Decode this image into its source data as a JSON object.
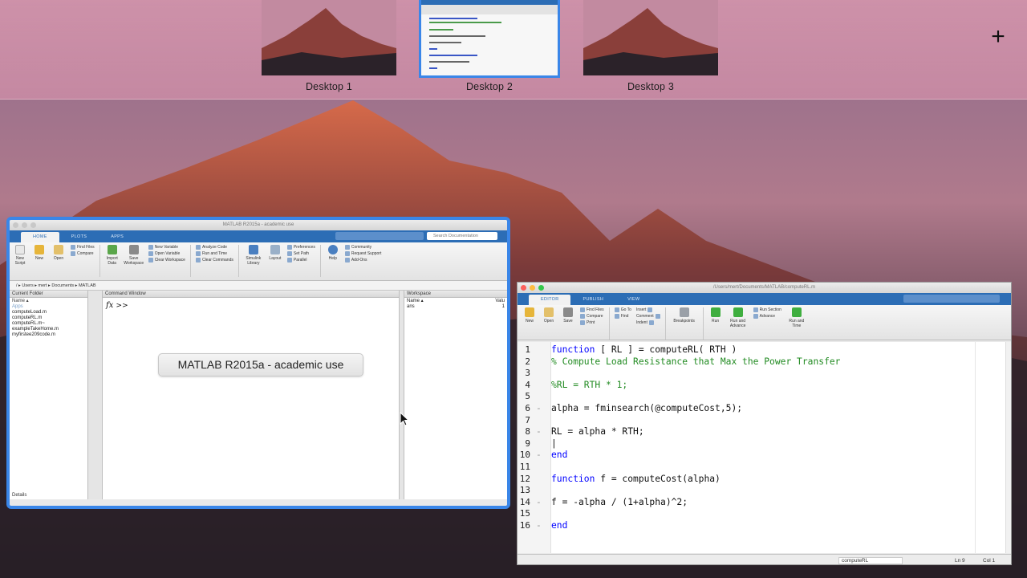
{
  "spaces": [
    {
      "label": "Desktop 1",
      "active": false
    },
    {
      "label": "Desktop 2",
      "active": true
    },
    {
      "label": "Desktop 3",
      "active": false
    }
  ],
  "add_space_symbol": "+",
  "main_window": {
    "title": "MATLAB R2015a - academic use",
    "tabs": [
      "HOME",
      "PLOTS",
      "APPS"
    ],
    "search_placeholder": "Search Documentation",
    "ribbon": {
      "new_script": "New Script",
      "new": "New",
      "open": "Open",
      "find_files": "Find Files",
      "compare": "Compare",
      "import_data": "Import Data",
      "save_workspace": "Save Workspace",
      "new_variable": "New Variable",
      "open_variable": "Open Variable",
      "clear_workspace": "Clear Workspace",
      "analyze_code": "Analyze Code",
      "run_and_time": "Run and Time",
      "clear_commands": "Clear Commands",
      "simulink_library": "Simulink Library",
      "layout": "Layout",
      "preferences": "Preferences",
      "set_path": "Set Path",
      "parallel": "Parallel",
      "help": "Help",
      "community": "Community",
      "request_support": "Request Support",
      "add_ons": "Add-Ons"
    },
    "path": "/ ▸ Users ▸ mert ▸ Documents ▸ MATLAB",
    "current_folder": {
      "title": "Current Folder",
      "column": "Name ▴",
      "items": [
        "Apps",
        "computeLoad.m",
        "computeRL.m",
        "computeRL.m~",
        "exampleTakeHome.m",
        "myfirstee209code.m"
      ],
      "details": "Details"
    },
    "command_window": {
      "title": "Command Window",
      "fx": "fx",
      "prompt": ">>"
    },
    "workspace": {
      "title": "Workspace",
      "col_name": "Name ▴",
      "col_value": "Valu",
      "rows": [
        {
          "name": "ans",
          "value": "1"
        }
      ]
    },
    "tooltip": "MATLAB R2015a - academic use"
  },
  "editor_window": {
    "title": "/Users/mert/Documents/MATLAB/computeRL.m",
    "tabs": [
      "EDITOR",
      "PUBLISH",
      "VIEW"
    ],
    "ribbon": {
      "new": "New",
      "open": "Open",
      "save": "Save",
      "find_files": "Find Files",
      "compare": "Compare",
      "print": "Print",
      "go_to": "Go To",
      "find": "Find",
      "insert": "Insert",
      "comment": "Comment",
      "indent": "Indent",
      "breakpoints": "Breakpoints",
      "run": "Run",
      "run_and_advance": "Run and Advance",
      "run_section": "Run Section",
      "advance": "Advance",
      "run_and_time": "Run and Time"
    },
    "code_lines": [
      {
        "n": "1",
        "dash": "",
        "html": "<span class='kw'>function</span> [ RL ] = computeRL( RTH )"
      },
      {
        "n": "2",
        "dash": "",
        "html": "<span class='cm'>% Compute Load Resistance that Max the Power Transfer</span>"
      },
      {
        "n": "3",
        "dash": "",
        "html": ""
      },
      {
        "n": "4",
        "dash": "",
        "html": "<span class='cm'>%RL = RTH * 1;</span>"
      },
      {
        "n": "5",
        "dash": "",
        "html": ""
      },
      {
        "n": "6",
        "dash": "-",
        "html": "alpha = fminsearch(@computeCost,5);"
      },
      {
        "n": "7",
        "dash": "",
        "html": ""
      },
      {
        "n": "8",
        "dash": "-",
        "html": "RL = alpha * RTH;"
      },
      {
        "n": "9",
        "dash": "",
        "html": "|"
      },
      {
        "n": "10",
        "dash": "-",
        "html": "<span class='kw'>end</span>"
      },
      {
        "n": "11",
        "dash": "",
        "html": ""
      },
      {
        "n": "12",
        "dash": "",
        "html": "<span class='kw'>function</span> f = computeCost(alpha)"
      },
      {
        "n": "13",
        "dash": "",
        "html": ""
      },
      {
        "n": "14",
        "dash": "-",
        "html": "f = -alpha / (1+alpha)^2;"
      },
      {
        "n": "15",
        "dash": "",
        "html": ""
      },
      {
        "n": "16",
        "dash": "-",
        "html": "<span class='kw'>end</span>"
      }
    ],
    "status": {
      "file": "computeRL",
      "ln": "Ln  9",
      "col": "Col  1"
    }
  }
}
